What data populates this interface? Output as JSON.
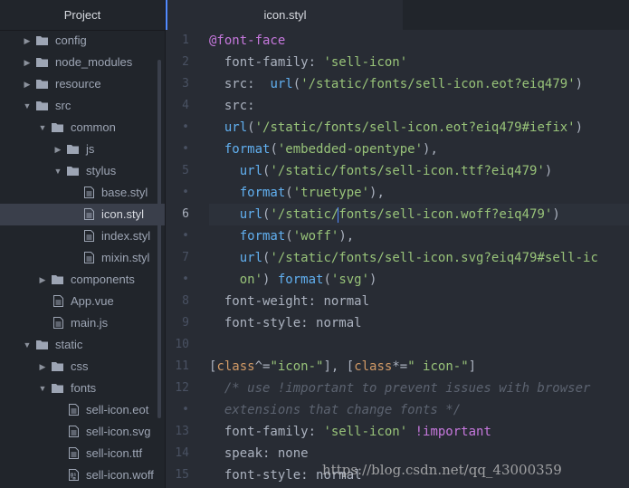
{
  "sidebar": {
    "title": "Project",
    "items": [
      {
        "label": "config",
        "type": "folder",
        "expanded": false,
        "depth": 0
      },
      {
        "label": "node_modules",
        "type": "folder",
        "expanded": false,
        "depth": 0
      },
      {
        "label": "resource",
        "type": "folder",
        "expanded": false,
        "depth": 0
      },
      {
        "label": "src",
        "type": "folder",
        "expanded": true,
        "depth": 0
      },
      {
        "label": "common",
        "type": "folder",
        "expanded": true,
        "depth": 1
      },
      {
        "label": "js",
        "type": "folder",
        "expanded": false,
        "depth": 2
      },
      {
        "label": "stylus",
        "type": "folder",
        "expanded": true,
        "depth": 2
      },
      {
        "label": "base.styl",
        "type": "file",
        "depth": 3
      },
      {
        "label": "icon.styl",
        "type": "file",
        "depth": 3,
        "selected": true
      },
      {
        "label": "index.styl",
        "type": "file",
        "depth": 3
      },
      {
        "label": "mixin.styl",
        "type": "file",
        "depth": 3
      },
      {
        "label": "components",
        "type": "folder",
        "expanded": false,
        "depth": 1
      },
      {
        "label": "App.vue",
        "type": "file",
        "depth": 1
      },
      {
        "label": "main.js",
        "type": "file",
        "depth": 1
      },
      {
        "label": "static",
        "type": "folder",
        "expanded": true,
        "depth": 0
      },
      {
        "label": "css",
        "type": "folder",
        "expanded": false,
        "depth": 1
      },
      {
        "label": "fonts",
        "type": "folder",
        "expanded": true,
        "depth": 1
      },
      {
        "label": "sell-icon.eot",
        "type": "file",
        "depth": 2
      },
      {
        "label": "sell-icon.svg",
        "type": "file",
        "depth": 2
      },
      {
        "label": "sell-icon.ttf",
        "type": "file",
        "depth": 2
      },
      {
        "label": "sell-icon.woff",
        "type": "binary",
        "depth": 2
      }
    ]
  },
  "editor": {
    "tab_title": "icon.styl",
    "lines": [
      {
        "num": "1",
        "tokens": [
          [
            "kw",
            "@font-face"
          ]
        ]
      },
      {
        "num": "2",
        "tokens": [
          [
            "plain",
            "  font-family"
          ],
          [
            "pun",
            ": "
          ],
          [
            "str",
            "'sell-icon'"
          ]
        ]
      },
      {
        "num": "3",
        "tokens": [
          [
            "plain",
            "  src"
          ],
          [
            "pun",
            ":  "
          ],
          [
            "fn",
            "url"
          ],
          [
            "pun",
            "("
          ],
          [
            "str",
            "'/static/fonts/sell-icon.eot?eiq479'"
          ],
          [
            "pun",
            ")"
          ]
        ]
      },
      {
        "num": "4",
        "tokens": [
          [
            "plain",
            "  src"
          ],
          [
            "pun",
            ":"
          ]
        ]
      },
      {
        "num": "•",
        "tokens": [
          [
            "plain",
            "  "
          ],
          [
            "fn",
            "url"
          ],
          [
            "pun",
            "("
          ],
          [
            "str",
            "'/static/fonts/sell-icon.eot?eiq479#iefix'"
          ],
          [
            "pun",
            ")"
          ]
        ]
      },
      {
        "num": "•",
        "tokens": [
          [
            "plain",
            "  "
          ],
          [
            "fn",
            "format"
          ],
          [
            "pun",
            "("
          ],
          [
            "str",
            "'embedded-opentype'"
          ],
          [
            "pun",
            "),"
          ]
        ]
      },
      {
        "num": "5",
        "tokens": [
          [
            "plain",
            "    "
          ],
          [
            "fn",
            "url"
          ],
          [
            "pun",
            "("
          ],
          [
            "str",
            "'/static/fonts/sell-icon.ttf?eiq479'"
          ],
          [
            "pun",
            ")"
          ]
        ]
      },
      {
        "num": "•",
        "tokens": [
          [
            "plain",
            "    "
          ],
          [
            "fn",
            "format"
          ],
          [
            "pun",
            "("
          ],
          [
            "str",
            "'truetype'"
          ],
          [
            "pun",
            "),"
          ]
        ]
      },
      {
        "num": "6",
        "current": true,
        "tokens": [
          [
            "plain",
            "    "
          ],
          [
            "fn",
            "url"
          ],
          [
            "pun",
            "("
          ],
          [
            "str",
            "'/static/"
          ],
          [
            "cursor",
            ""
          ],
          [
            "str",
            "fonts/sell-icon.woff?eiq479'"
          ],
          [
            "pun",
            ")"
          ]
        ]
      },
      {
        "num": "•",
        "tokens": [
          [
            "plain",
            "    "
          ],
          [
            "fn",
            "format"
          ],
          [
            "pun",
            "("
          ],
          [
            "str",
            "'woff'"
          ],
          [
            "pun",
            "),"
          ]
        ]
      },
      {
        "num": "7",
        "tokens": [
          [
            "plain",
            "    "
          ],
          [
            "fn",
            "url"
          ],
          [
            "pun",
            "("
          ],
          [
            "str",
            "'/static/fonts/sell-icon.svg?eiq479#sell-ic"
          ]
        ]
      },
      {
        "num": "•",
        "tokens": [
          [
            "str",
            "    on'"
          ],
          [
            "pun",
            ") "
          ],
          [
            "fn",
            "format"
          ],
          [
            "pun",
            "("
          ],
          [
            "str",
            "'svg'"
          ],
          [
            "pun",
            ")"
          ]
        ]
      },
      {
        "num": "8",
        "tokens": [
          [
            "plain",
            "  font-weight"
          ],
          [
            "pun",
            ": "
          ],
          [
            "plain",
            "normal"
          ]
        ]
      },
      {
        "num": "9",
        "tokens": [
          [
            "plain",
            "  font-style"
          ],
          [
            "pun",
            ": "
          ],
          [
            "plain",
            "normal"
          ]
        ]
      },
      {
        "num": "10",
        "tokens": []
      },
      {
        "num": "11",
        "tokens": [
          [
            "pun",
            "["
          ],
          [
            "attr",
            "class"
          ],
          [
            "pun",
            "^="
          ],
          [
            "str",
            "\"icon-\""
          ],
          [
            "pun",
            "], ["
          ],
          [
            "attr",
            "class"
          ],
          [
            "pun",
            "*="
          ],
          [
            "str",
            "\" icon-\""
          ],
          [
            "pun",
            "]"
          ]
        ]
      },
      {
        "num": "12",
        "tokens": [
          [
            "cmt",
            "  /* use !important to prevent issues with browser"
          ]
        ]
      },
      {
        "num": "•",
        "tokens": [
          [
            "cmt",
            "  extensions that change fonts */"
          ]
        ]
      },
      {
        "num": "13",
        "tokens": [
          [
            "plain",
            "  font-family"
          ],
          [
            "pun",
            ": "
          ],
          [
            "str",
            "'sell-icon'"
          ],
          [
            "plain",
            " "
          ],
          [
            "kw",
            "!important"
          ]
        ]
      },
      {
        "num": "14",
        "tokens": [
          [
            "plain",
            "  speak"
          ],
          [
            "pun",
            ": "
          ],
          [
            "plain",
            "none"
          ]
        ]
      },
      {
        "num": "15",
        "tokens": [
          [
            "plain",
            "  font-style"
          ],
          [
            "pun",
            ": "
          ],
          [
            "plain",
            "normal"
          ]
        ]
      }
    ]
  },
  "watermark": "https://blog.csdn.net/qq_43000359",
  "colors": {
    "background": "#282c34",
    "sidebar": "#21252b",
    "accent": "#528bff",
    "keyword": "#c678dd",
    "string": "#98c379",
    "function": "#61afef"
  }
}
